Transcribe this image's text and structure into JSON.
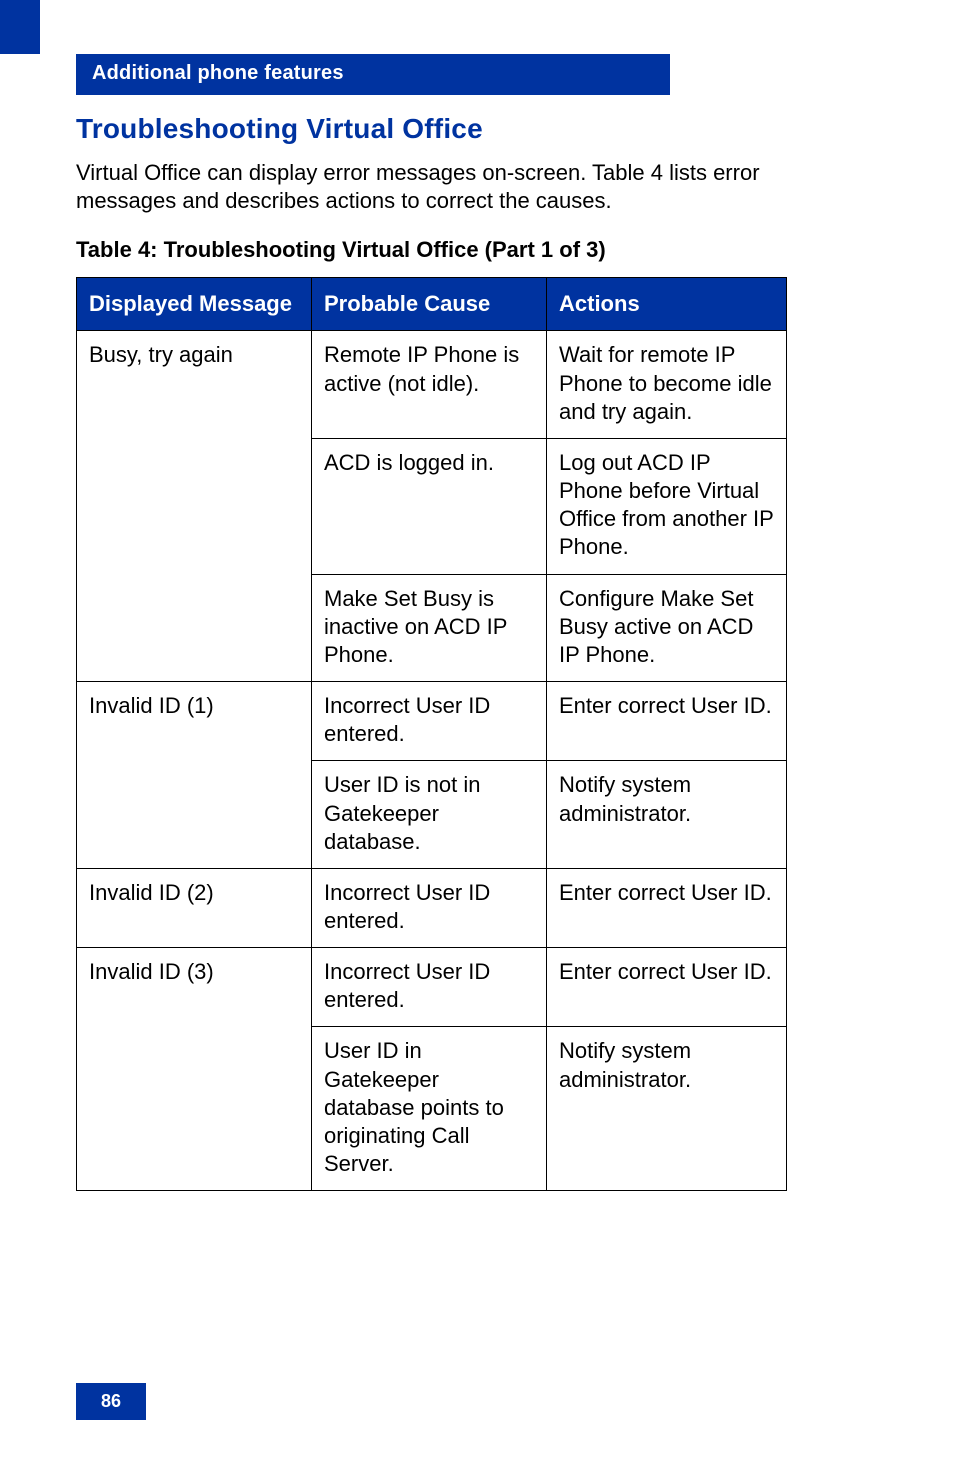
{
  "section_header": "Additional phone features",
  "heading": "Troubleshooting Virtual Office",
  "intro": "Virtual Office can display error messages on-screen. Table 4 lists error messages and describes actions to correct the causes.",
  "table_caption": "Table 4: Troubleshooting Virtual Office (Part 1 of 3)",
  "table": {
    "headers": {
      "c1": "Displayed Message",
      "c2": "Probable Cause",
      "c3": "Actions"
    },
    "rows": [
      {
        "msg": "Busy, try again",
        "msg_rowspan": 3,
        "cause": "Remote IP Phone is active (not idle).",
        "action": "Wait for remote IP Phone to become idle and try again."
      },
      {
        "cause": "ACD is logged in.",
        "action": "Log out ACD IP Phone before Virtual Office from another IP Phone."
      },
      {
        "cause": "Make Set Busy is inactive on ACD IP Phone.",
        "action": "Configure Make Set Busy active on ACD IP Phone."
      },
      {
        "msg": "Invalid ID (1)",
        "msg_rowspan": 2,
        "cause": "Incorrect User ID entered.",
        "action": "Enter correct User ID."
      },
      {
        "cause": "User ID is not in Gatekeeper database.",
        "action": "Notify system administrator."
      },
      {
        "msg": "Invalid ID (2)",
        "msg_rowspan": 1,
        "cause": "Incorrect User ID entered.",
        "action": "Enter correct User ID."
      },
      {
        "msg": "Invalid ID (3)",
        "msg_rowspan": 2,
        "cause": "Incorrect User ID entered.",
        "action": "Enter correct User ID."
      },
      {
        "cause": "User ID in Gatekeeper database points to originating Call Server.",
        "action": "Notify system administrator."
      }
    ]
  },
  "page_number": "86"
}
